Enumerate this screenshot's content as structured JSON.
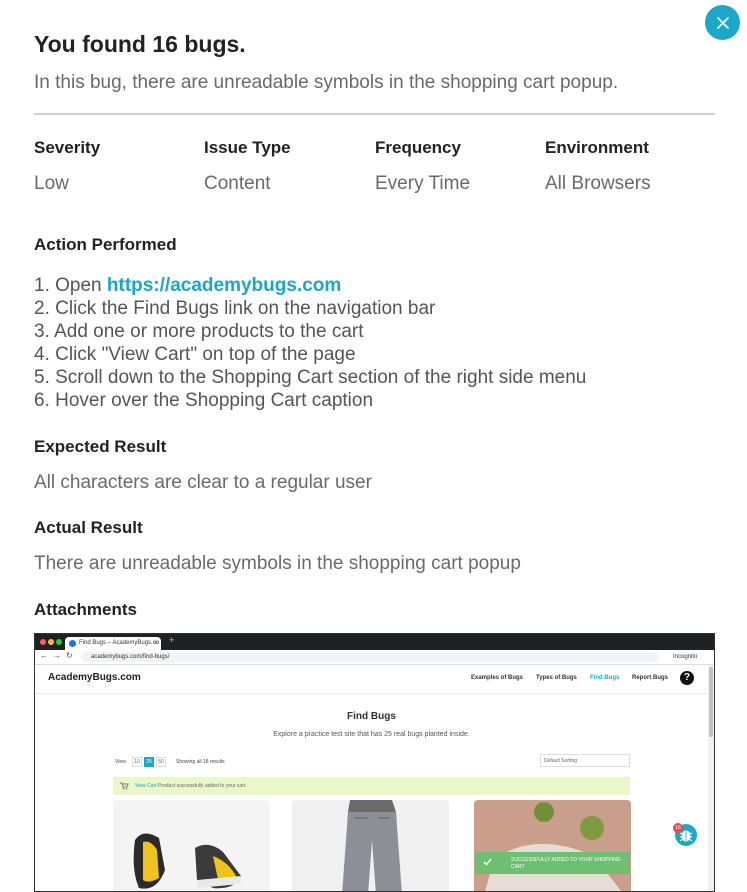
{
  "modal": {
    "title": "You found 16 bugs.",
    "subtitle": "In this bug, there are unreadable symbols in the shopping cart popup.",
    "accent_color": "#1ba8c8"
  },
  "meta": [
    {
      "label": "Severity",
      "value": "Low"
    },
    {
      "label": "Issue Type",
      "value": "Content"
    },
    {
      "label": "Frequency",
      "value": "Every Time"
    },
    {
      "label": "Environment",
      "value": "All Browsers"
    }
  ],
  "action": {
    "title": "Action Performed",
    "steps": [
      {
        "prefix": "1. Open ",
        "link": "https://academybugs.com"
      },
      {
        "text": "2. Click the Find Bugs link on the navigation bar"
      },
      {
        "text": "3. Add one or more products to the cart"
      },
      {
        "text": "4. Click \"View Cart\" on top of the page"
      },
      {
        "text": "5. Scroll down to the Shopping Cart section of the right side menu"
      },
      {
        "text": "6. Hover over the Shopping Cart caption"
      }
    ]
  },
  "expected": {
    "title": "Expected Result",
    "text": "All characters are clear to a regular user"
  },
  "actual": {
    "title": "Actual Result",
    "text": "There are unreadable symbols in the shopping cart popup"
  },
  "attachments": {
    "title": "Attachments",
    "screenshot": {
      "tab_title": "Find Bugs – AcademyBugs.co",
      "url": "academybugs.com/find-bugs/",
      "incognito_label": "Incognito",
      "logo": "AcademyBugs.com",
      "nav": [
        "Examples of Bugs",
        "Types of Bugs",
        "Find Bugs",
        "Report Bugs"
      ],
      "active_nav": "Find Bugs",
      "heading": "Find Bugs",
      "subheading": "Explore a practice test site that has 25 real bugs planted inside.",
      "view_label": "View",
      "view_options": [
        "10",
        "25",
        "50"
      ],
      "results_text": "Showing all 18 results",
      "sort_label": "Default Sorting",
      "notice_link": "View Cart",
      "notice_text": "Product successfully added to your cart.",
      "toast_text": "SUCCESSFULLY ADDED TO YOUR SHOPPING CART",
      "bug_count": "16"
    }
  }
}
